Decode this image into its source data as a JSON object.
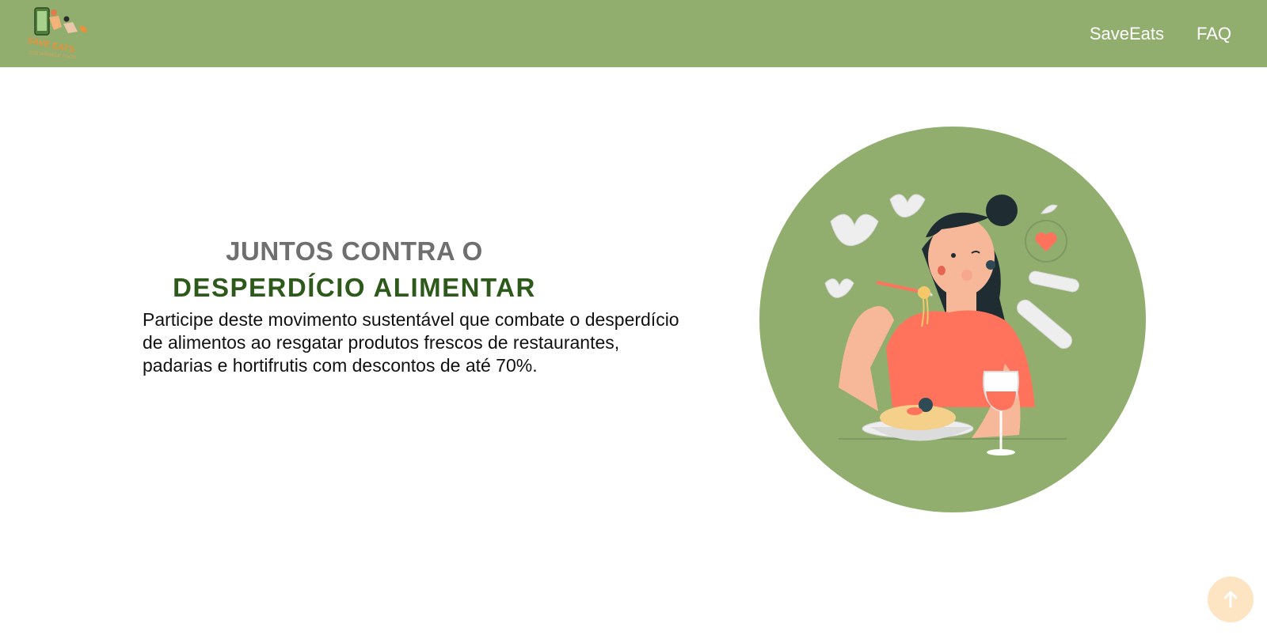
{
  "header": {
    "logo_alt": "SaveEats",
    "nav": [
      {
        "label": "SaveEats"
      },
      {
        "label": "FAQ"
      }
    ]
  },
  "hero": {
    "title_line1": "JUNTOS CONTRA O",
    "title_line2": "DESPERDÍCIO ALIMENTAR",
    "description": "Participe deste movimento sustentável que combate o desperdício de alimentos ao resgatar produtos frescos de restaurantes, padarias e hortifrutis com descontos de até 70%."
  },
  "scroll_top": {
    "icon": "arrow-up-icon"
  },
  "colors": {
    "header_bg": "#91ae6f",
    "title_gray": "#6f6f6f",
    "title_green": "#2d5a1b",
    "circle_bg": "#91ae6f",
    "shirt": "#ff735c",
    "scroll_btn": "#fde4c3"
  }
}
